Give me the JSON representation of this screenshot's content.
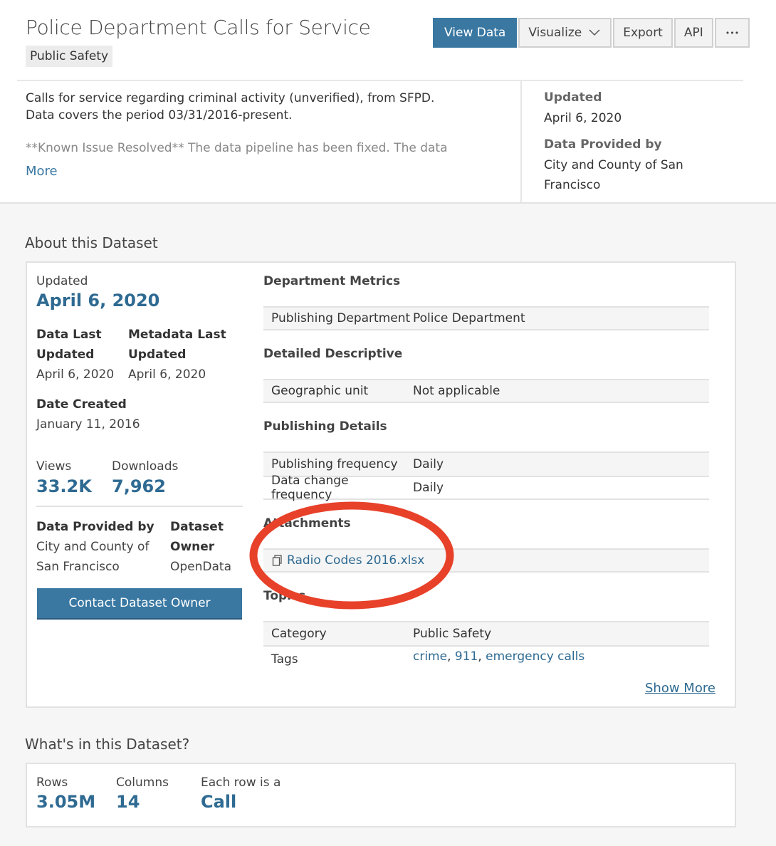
{
  "header": {
    "title": "Police Department Calls for Service",
    "category": "Public Safety",
    "buttons": {
      "view_data": "View Data",
      "visualize": "Visualize",
      "export": "Export",
      "api": "API",
      "more": "•••"
    }
  },
  "description": {
    "line": "Calls for service regarding criminal activity (unverified), from SFPD. Data covers the period 03/31/2016-present.",
    "faded": "**Known Issue Resolved** The data pipeline has been fixed. The data",
    "more": "More"
  },
  "sidebar": {
    "updated_label": "Updated",
    "updated_value": "April 6, 2020",
    "provided_label": "Data Provided by",
    "provided_value": "City and County of San Francisco"
  },
  "about": {
    "heading": "About this Dataset",
    "updated_label": "Updated",
    "updated_value": "April 6, 2020",
    "data_last_updated_label": "Data Last Updated",
    "data_last_updated_value": "April 6, 2020",
    "metadata_last_updated_label": "Metadata Last Updated",
    "metadata_last_updated_value": "April 6, 2020",
    "date_created_label": "Date Created",
    "date_created_value": "January 11, 2016",
    "views_label": "Views",
    "views_value": "33.2K",
    "downloads_label": "Downloads",
    "downloads_value": "7,962",
    "provided_label": "Data Provided by",
    "provided_value": "City and County of San Francisco",
    "owner_label": "Dataset Owner",
    "owner_value": "OpenData",
    "contact": "Contact Dataset Owner",
    "sections": {
      "dept_metrics": "Department Metrics",
      "publishing_department_k": "Publishing Department",
      "publishing_department_v": "Police Department",
      "detailed": "Detailed Descriptive",
      "geo_k": "Geographic unit",
      "geo_v": "Not applicable",
      "publishing": "Publishing Details",
      "freq_k": "Publishing frequency",
      "freq_v": "Daily",
      "change_k": "Data change frequency",
      "change_v": "Daily",
      "attachments": "Attachments",
      "attachment_file": "Radio Codes 2016.xlsx",
      "topics": "Topics",
      "category_k": "Category",
      "category_v": "Public Safety",
      "tags_k": "Tags",
      "tags": [
        "crime",
        "911",
        "emergency calls"
      ]
    },
    "show_more": "Show More"
  },
  "whats_in": {
    "heading": "What's in this Dataset?",
    "rows_label": "Rows",
    "rows_value": "3.05M",
    "columns_label": "Columns",
    "columns_value": "14",
    "each_row_label": "Each row is a",
    "each_row_value": "Call"
  },
  "annotation_color": "#e8412a"
}
